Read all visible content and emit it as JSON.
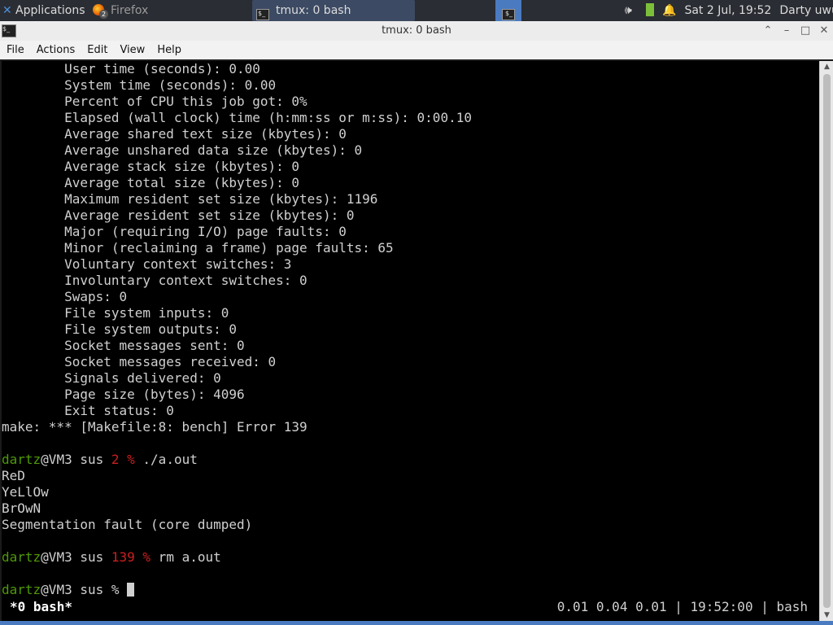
{
  "panel": {
    "applications_label": "Applications",
    "firefox_label": "Firefox",
    "firefox_badge": "2",
    "tmux_task_label": "tmux: 0 bash",
    "volume_icon": "🕪",
    "bell_icon": "🔔",
    "clock": "Sat  2 Jul, 19:52",
    "user": "Darty uwu"
  },
  "window": {
    "title": "tmux: 0 bash",
    "menu": [
      "File",
      "Actions",
      "Edit",
      "View",
      "Help"
    ]
  },
  "terminal": {
    "lines": [
      "        User time (seconds): 0.00",
      "        System time (seconds): 0.00",
      "        Percent of CPU this job got: 0%",
      "        Elapsed (wall clock) time (h:mm:ss or m:ss): 0:00.10",
      "        Average shared text size (kbytes): 0",
      "        Average unshared data size (kbytes): 0",
      "        Average stack size (kbytes): 0",
      "        Average total size (kbytes): 0",
      "        Maximum resident set size (kbytes): 1196",
      "        Average resident set size (kbytes): 0",
      "        Major (requiring I/O) page faults: 0",
      "        Minor (reclaiming a frame) page faults: 65",
      "        Voluntary context switches: 3",
      "        Involuntary context switches: 0",
      "        Swaps: 0",
      "        File system inputs: 0",
      "        File system outputs: 0",
      "        Socket messages sent: 0",
      "        Socket messages received: 0",
      "        Signals delivered: 0",
      "        Page size (bytes): 4096",
      "        Exit status: 0",
      "make: *** [Makefile:8: bench] Error 139"
    ],
    "prompt1": {
      "user": "dartz",
      "host": "@VM3 sus ",
      "code": "2 %",
      "cmd": " ./a.out"
    },
    "output1": [
      "ReD",
      "YeLlOw",
      "BrOwN",
      "Segmentation fault (core dumped)"
    ],
    "prompt2": {
      "user": "dartz",
      "host": "@VM3 sus ",
      "code": "139 %",
      "cmd": " rm a.out"
    },
    "prompt3": {
      "user": "dartz",
      "host": "@VM3 sus % "
    }
  },
  "tmux_status": {
    "left": "*0 bash*",
    "right": "0.01 0.04 0.01 | 19:52:00 | bash"
  },
  "colors": {
    "prompt_user": "#4e9a06",
    "prompt_code": "#cc1f1f",
    "terminal_bg": "#000000",
    "panel_bg": "#2a2d33"
  }
}
